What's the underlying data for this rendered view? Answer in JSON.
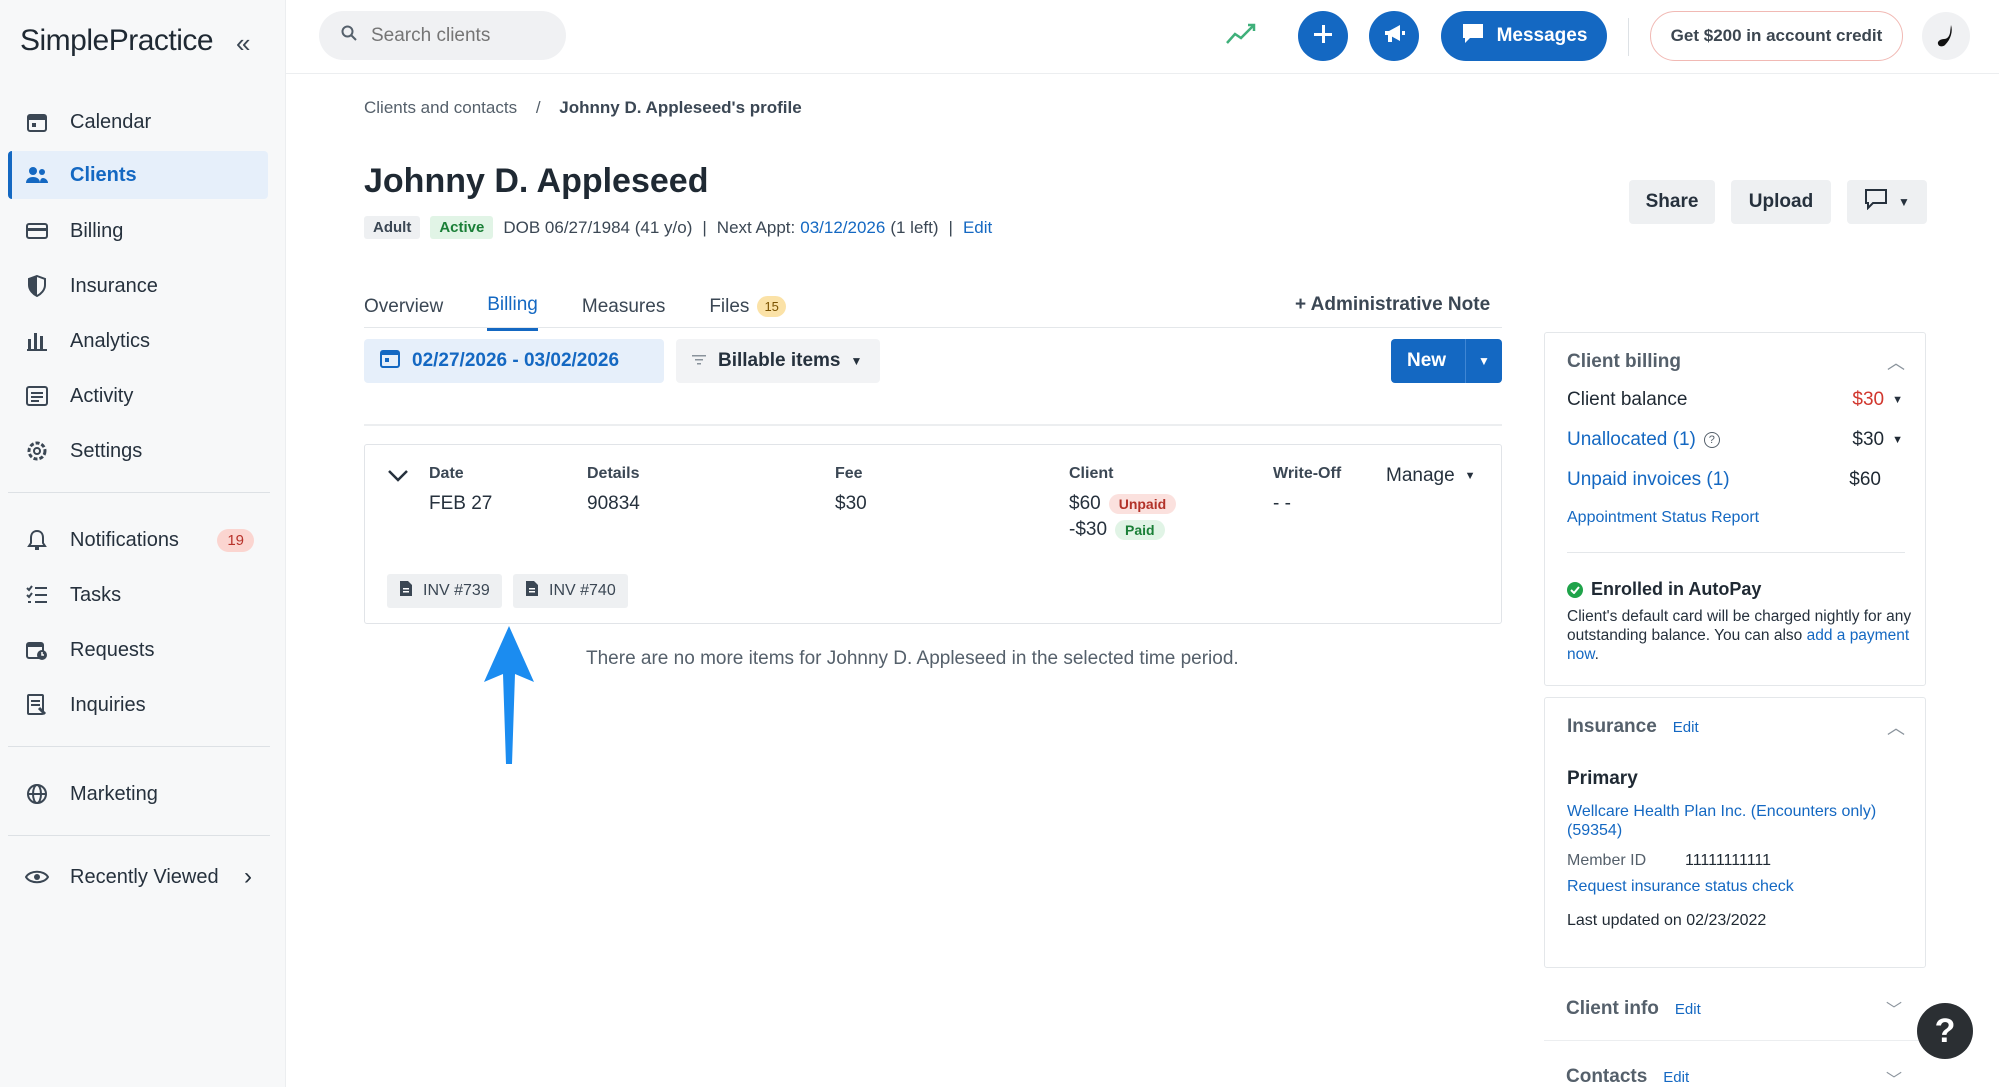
{
  "sidebar": {
    "logo": "SimplePractice",
    "items": [
      {
        "label": "Calendar"
      },
      {
        "label": "Clients"
      },
      {
        "label": "Billing"
      },
      {
        "label": "Insurance"
      },
      {
        "label": "Analytics"
      },
      {
        "label": "Activity"
      },
      {
        "label": "Settings"
      },
      {
        "label": "Notifications",
        "badge": "19"
      },
      {
        "label": "Tasks"
      },
      {
        "label": "Requests"
      },
      {
        "label": "Inquiries"
      },
      {
        "label": "Marketing"
      },
      {
        "label": "Recently Viewed"
      }
    ]
  },
  "topbar": {
    "search_placeholder": "Search clients",
    "messages_label": "Messages",
    "credit_label": "Get $200 in account credit"
  },
  "breadcrumb": {
    "parent": "Clients and contacts",
    "separator": "/",
    "current": "Johnny D. Appleseed's profile"
  },
  "client": {
    "name": "Johnny D. Appleseed",
    "tag_adult": "Adult",
    "tag_status": "Active",
    "dob": "DOB 06/27/1984 (41 y/o)",
    "sep": "|",
    "next_appt_label": "Next Appt:",
    "next_appt_date": "03/12/2026",
    "next_appt_left": "(1 left)",
    "edit": "Edit"
  },
  "profile_actions": {
    "share": "Share",
    "upload": "Upload"
  },
  "tabs": [
    {
      "label": "Overview"
    },
    {
      "label": "Billing"
    },
    {
      "label": "Measures"
    },
    {
      "label": "Files",
      "badge": "15"
    }
  ],
  "admin_note": "+ Administrative Note",
  "filters": {
    "date_range": "02/27/2026 - 03/02/2026",
    "billable": "Billable items",
    "new": "New"
  },
  "billing_item": {
    "headers": {
      "date": "Date",
      "details": "Details",
      "fee": "Fee",
      "client": "Client",
      "writeoff": "Write-Off"
    },
    "date": "FEB 27",
    "details": "90834",
    "fee": "$30",
    "client_charge": "$60",
    "client_charge_status": "Unpaid",
    "client_payment": "-$30",
    "client_payment_status": "Paid",
    "writeoff": "- -",
    "manage": "Manage",
    "invoices": [
      "INV #739",
      "INV #740"
    ]
  },
  "no_more_items": "There are no more items for Johnny D. Appleseed in the selected time period.",
  "client_billing": {
    "title": "Client billing",
    "balance_label": "Client balance",
    "balance_value": "$30",
    "unallocated_label": "Unallocated (1)",
    "unallocated_value": "$30",
    "unpaid_label": "Unpaid invoices (1)",
    "unpaid_value": "$60",
    "status_report": "Appointment Status Report",
    "autopay_title": "Enrolled in AutoPay",
    "autopay_text": "Client's default card will be charged nightly for any outstanding balance. You can also",
    "autopay_link": "add a payment now",
    "autopay_end": "."
  },
  "insurance": {
    "title": "Insurance",
    "edit": "Edit",
    "primary": "Primary",
    "plan": "Wellcare Health Plan Inc. (Encounters only) (59354)",
    "member_label": "Member ID",
    "member_value": "11111111111",
    "check": "Request insurance status check",
    "updated": "Last updated on 02/23/2022"
  },
  "client_info": {
    "title": "Client info",
    "edit": "Edit"
  },
  "contacts": {
    "title": "Contacts",
    "edit": "Edit"
  },
  "help": "?"
}
